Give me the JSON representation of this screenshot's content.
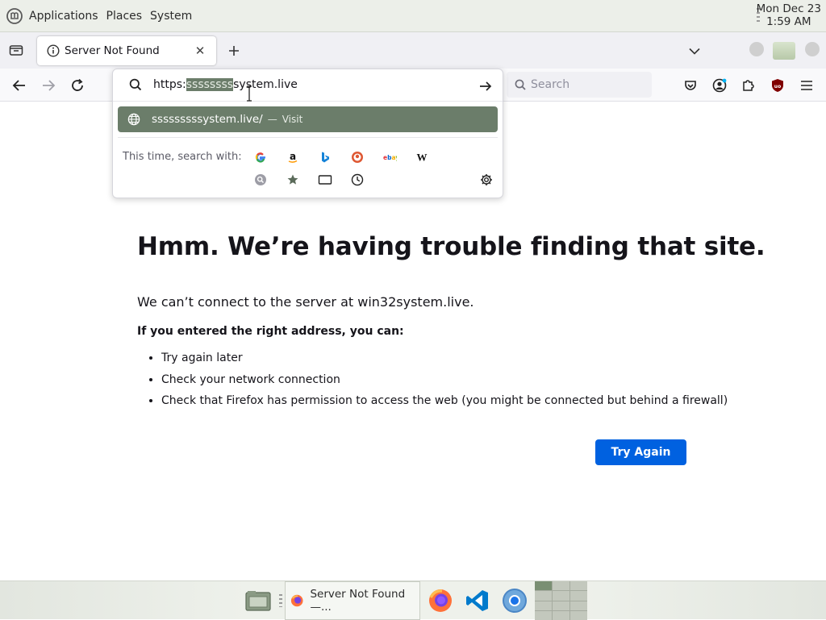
{
  "top_panel": {
    "menus": [
      "Applications",
      "Places",
      "System"
    ],
    "clock": {
      "date": "Mon Dec 23",
      "time": "1:59 AM"
    }
  },
  "tabs": [
    {
      "title": "Server Not Found",
      "icon": "info-icon",
      "active": true
    }
  ],
  "urlbar": {
    "prefix": "https:",
    "selected": "ssssssss",
    "suffix": "system.live",
    "suggestion": {
      "url": "sssssssssystem.live/",
      "separator": "—",
      "action": "Visit"
    },
    "oneoff_label": "This time, search with:",
    "engines": [
      "Google",
      "Amazon",
      "Bing",
      "DuckDuckGo",
      "eBay",
      "Wikipedia"
    ],
    "modes": [
      "history-search-icon",
      "bookmarks-star-icon",
      "tabs-icon",
      "history-clock-icon"
    ]
  },
  "search": {
    "placeholder": "Search"
  },
  "error": {
    "title": "Hmm. We’re having trouble finding that site.",
    "description": "We can’t connect to the server at win32system.live.",
    "subtitle": "If you entered the right address, you can:",
    "items": [
      "Try again later",
      "Check your network connection",
      "Check that Firefox has permission to access the web (you might be connected but behind a firewall)"
    ],
    "button": "Try Again"
  },
  "taskbar": {
    "task_title": "Server Not Found —...",
    "launchers": [
      "file-manager-icon",
      "firefox-icon",
      "vscode-icon",
      "chromium-icon"
    ]
  },
  "colors": {
    "accent_button": "#0061e0",
    "suggestion_highlight": "#6b7d6a",
    "panel_bg": "#ecefe9"
  }
}
